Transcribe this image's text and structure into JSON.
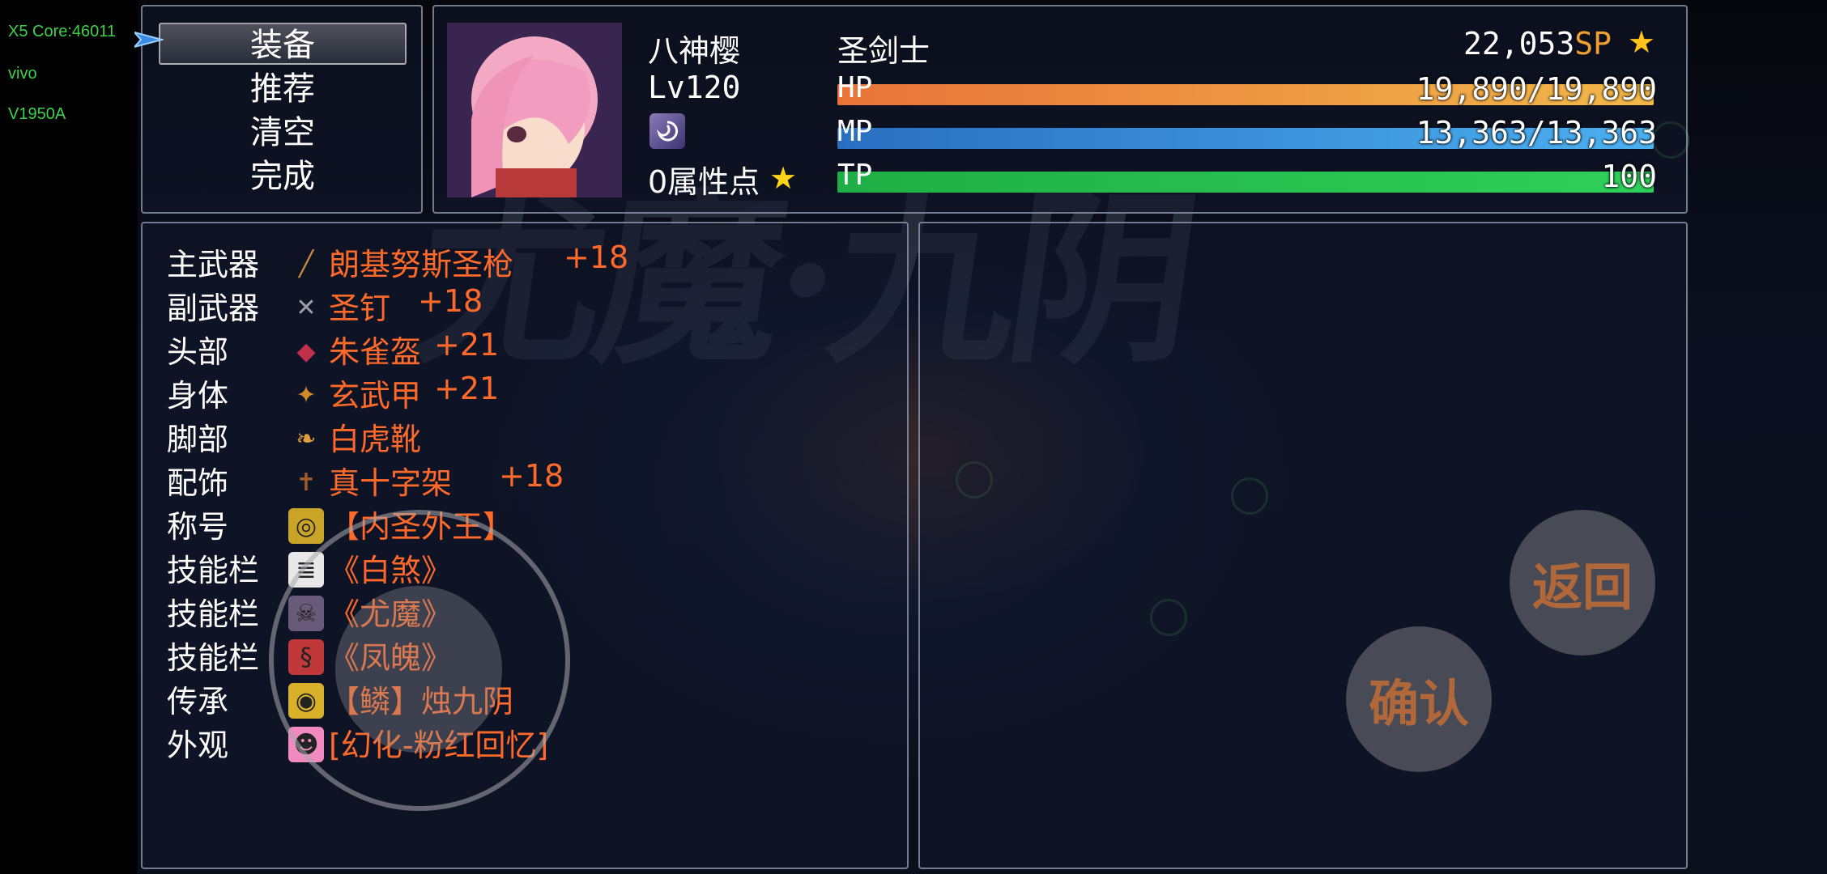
{
  "debug": [
    "X5 Core:46011",
    "vivo",
    "V1950A"
  ],
  "commands": [
    {
      "label": "装备",
      "selected": true
    },
    {
      "label": "推荐",
      "selected": false
    },
    {
      "label": "清空",
      "selected": false
    },
    {
      "label": "完成",
      "selected": false
    }
  ],
  "actor": {
    "name": "八神樱",
    "class": "圣剑士",
    "level": "Lv120",
    "points": "0属性点",
    "sp_value": "22,053",
    "sp_unit": "SP",
    "hp_label": "HP",
    "hp_value": "19,890/19,890",
    "hp_fill": 1.0,
    "mp_label": "MP",
    "mp_value": "13,363/13,363",
    "mp_fill": 1.0,
    "tp_label": "TP",
    "tp_value": "100",
    "tp_fill": 1.0
  },
  "equipment": [
    {
      "slot": "主武器",
      "icon": "spear-icon",
      "name": "朗基努斯圣枪",
      "plus": "+18",
      "icon_color": "#c88a3a"
    },
    {
      "slot": "副武器",
      "icon": "nail-icon",
      "name": "圣钉",
      "plus": "+18",
      "icon_color": "#9aa0a6"
    },
    {
      "slot": "头部",
      "icon": "helmet-icon",
      "name": "朱雀盔",
      "plus": "+21",
      "icon_color": "#c0304a"
    },
    {
      "slot": "身体",
      "icon": "armor-icon",
      "name": "玄武甲",
      "plus": "+21",
      "icon_color": "#d08a2a"
    },
    {
      "slot": "脚部",
      "icon": "boots-icon",
      "name": "白虎靴",
      "plus": "",
      "icon_color": "#e0a040"
    },
    {
      "slot": "配饰",
      "icon": "cross-icon",
      "name": "真十字架",
      "plus": "+18",
      "icon_color": "#a05a2a"
    },
    {
      "slot": "称号",
      "icon": "title-badge-icon",
      "name": "【内圣外王】",
      "plus": "",
      "icon_color": "#c9a427"
    },
    {
      "slot": "技能栏",
      "icon": "skill-scroll-icon",
      "name": "《白煞》",
      "plus": "",
      "icon_color": "#e8e8e8"
    },
    {
      "slot": "技能栏",
      "icon": "skull-skill-icon",
      "name": "《尤魔》",
      "plus": "",
      "icon_color": "#6a5a7a"
    },
    {
      "slot": "技能栏",
      "icon": "flame-skill-icon",
      "name": "《凤魄》",
      "plus": "",
      "icon_color": "#c0383a"
    },
    {
      "slot": "传承",
      "icon": "inheritance-eye-icon",
      "name": "【鳞】烛九阴",
      "plus": "",
      "icon_color": "#d9b02a"
    },
    {
      "slot": "外观",
      "icon": "pink-face-icon",
      "name": "[幻化-粉红回忆]",
      "plus": "",
      "icon_color": "#f08ac0"
    }
  ],
  "buttons": {
    "back": "返回",
    "confirm": "确认"
  },
  "colors": {
    "hp_start": "#e8733a",
    "hp_end": "#f2b84a",
    "mp_start": "#2a6ec0",
    "mp_end": "#4cb0f0",
    "tp_start": "#1fae45",
    "tp_end": "#2fd05a",
    "item_name": "#ff6a2a"
  }
}
